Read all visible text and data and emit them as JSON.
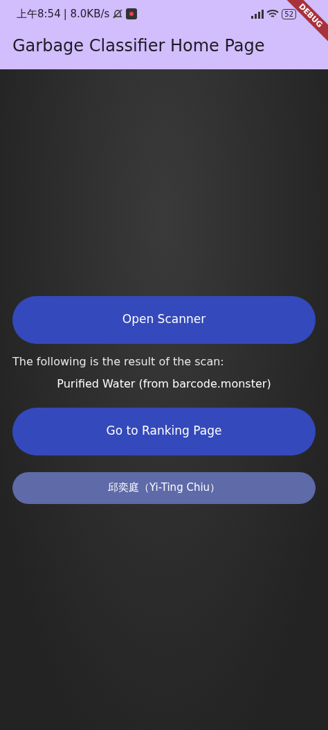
{
  "status_bar": {
    "time": "上午8:54",
    "speed": "| 8.0KB/s",
    "battery": "52"
  },
  "debug_banner": "DEBUG",
  "app_bar": {
    "title": "Garbage Classifier Home Page"
  },
  "content": [
    {
      "kind": "button",
      "label": "Open Scanner"
    },
    {
      "kind": "caption",
      "text": "The following is the result of the scan:"
    },
    {
      "kind": "result",
      "text": "Purified Water (from barcode.monster)"
    },
    {
      "kind": "button",
      "label": "Go to Ranking Page"
    },
    {
      "kind": "credit",
      "label": "邱奕庭（Yi-Ting Chiu）"
    }
  ]
}
